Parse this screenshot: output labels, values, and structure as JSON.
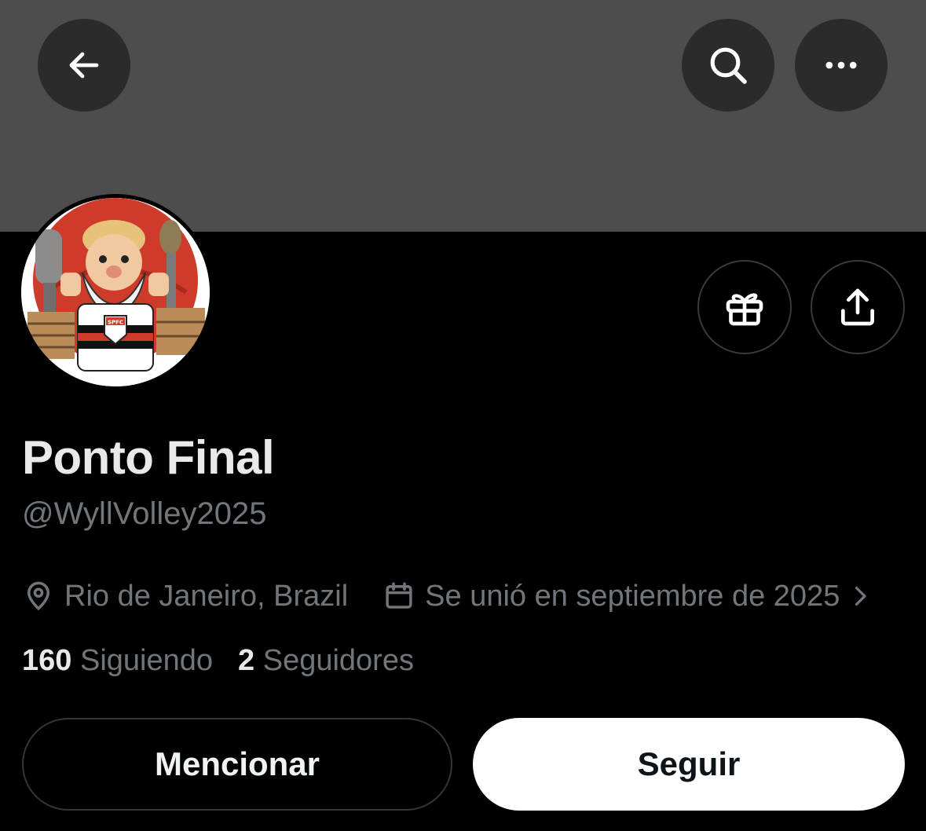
{
  "profile": {
    "name": "Ponto Final",
    "handle": "@WyllVolley2025",
    "location": "Rio de Janeiro, Brazil",
    "joined": "Se unió en septiembre de 2025",
    "following_count": "160",
    "following_label": "Siguiendo",
    "followers_count": "2",
    "followers_label": "Seguidores",
    "avatar_badge": "SPFC"
  },
  "actions": {
    "mention_label": "Mencionar",
    "follow_label": "Seguir"
  },
  "icons": {
    "back": "arrow-left-icon",
    "search": "search-icon",
    "more": "more-horizontal-icon",
    "gift": "gift-icon",
    "share": "share-icon",
    "location": "location-pin-icon",
    "calendar": "calendar-icon",
    "chevron": "chevron-right-icon"
  },
  "colors": {
    "background": "#000000",
    "banner": "#4d4d4d",
    "secondary_text": "#71767b",
    "primary_text": "#e7e9ea"
  }
}
